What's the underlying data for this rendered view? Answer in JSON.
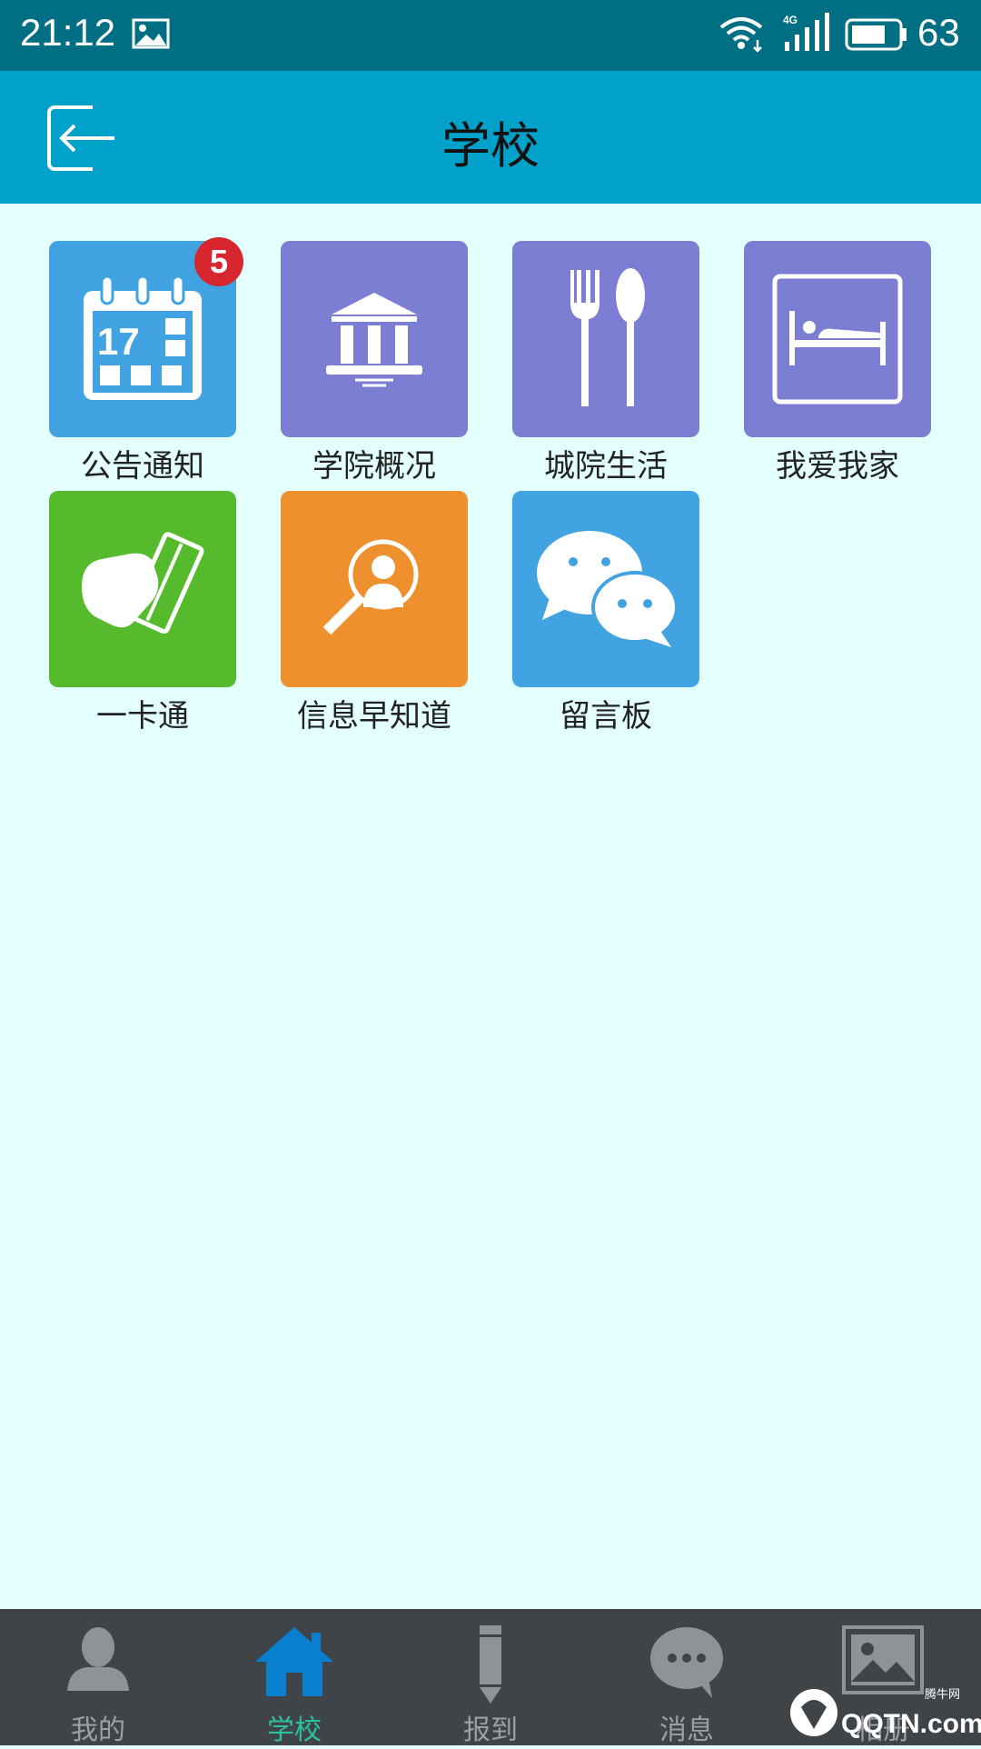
{
  "status_bar": {
    "time": "21:12",
    "battery": "63",
    "network": "4G",
    "icons": [
      "image-icon",
      "wifi-icon",
      "signal-icon",
      "battery-icon"
    ]
  },
  "header": {
    "title": "学校",
    "back_icon": "exit-back-icon",
    "color": "#01a1c9"
  },
  "tiles": [
    {
      "label": "公告通知",
      "icon": "calendar-icon",
      "color": "#42a3e2",
      "badge": "5",
      "icon_text": "17"
    },
    {
      "label": "学院概况",
      "icon": "institution-icon",
      "color": "#7b7ed2"
    },
    {
      "label": "城院生活",
      "icon": "fork-spoon-icon",
      "color": "#7b7ed2"
    },
    {
      "label": "我爱我家",
      "icon": "bed-icon",
      "color": "#7b7ed2"
    },
    {
      "label": "一卡通",
      "icon": "card-icon",
      "color": "#55bb2d"
    },
    {
      "label": "信息早知道",
      "icon": "search-person-icon",
      "color": "#ee902d"
    },
    {
      "label": "留言板",
      "icon": "chat-bubbles-icon",
      "color": "#42a3e2"
    }
  ],
  "bottom_nav": {
    "items": [
      {
        "label": "我的",
        "icon": "person-icon"
      },
      {
        "label": "学校",
        "icon": "home-icon",
        "active": true
      },
      {
        "label": "报到",
        "icon": "pencil-icon"
      },
      {
        "label": "消息",
        "icon": "message-bubble-icon"
      },
      {
        "label": "相册",
        "icon": "picture-icon"
      }
    ],
    "active_color": "#2ec29a"
  },
  "watermark": {
    "text": "QQTN.com",
    "subtext": "腾牛网"
  }
}
